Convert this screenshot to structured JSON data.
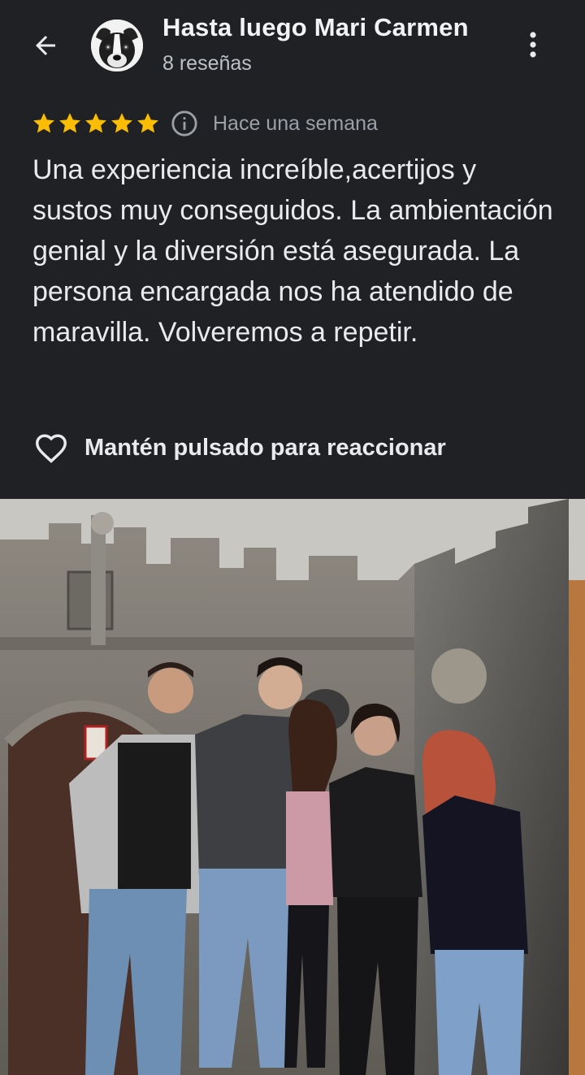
{
  "header": {
    "author_name": "Hasta luego Mari Carmen",
    "review_count": "8 reseñas",
    "icons": {
      "back": "arrow-back-icon",
      "more": "more-vert-icon"
    }
  },
  "review": {
    "rating": 5,
    "max_rating": 5,
    "time_ago": "Hace una semana",
    "text": "Una experiencia increíble,acertijos y sustos muy conseguidos. La ambientación genial y la diversión está asegurada. La persona encargada nos ha atendido de maravilla. Volveremos a repetir.",
    "react_label": "Mantén pulsado para reaccionar"
  },
  "colors": {
    "background": "#202124",
    "star": "#fbbc04",
    "text_primary": "#e8eaed",
    "text_secondary": "#9aa0a6"
  }
}
